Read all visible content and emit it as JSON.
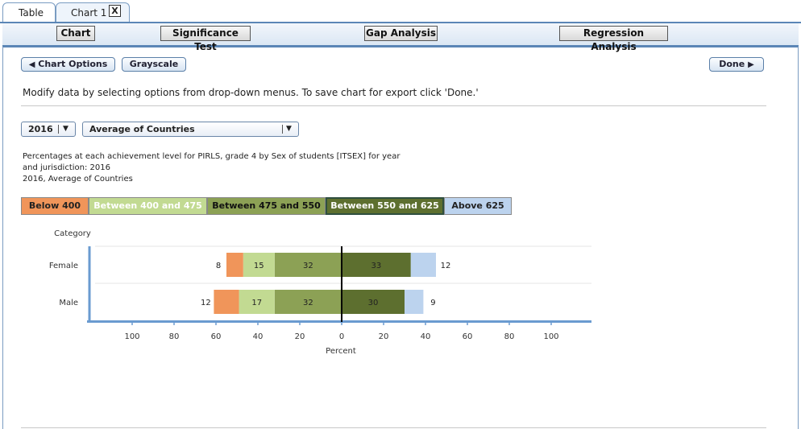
{
  "tabs": {
    "table": "Table",
    "chart1": "Chart 1",
    "close": "X"
  },
  "nav": {
    "chart": "Chart",
    "significance": "Significance Test",
    "gap": "Gap Analysis",
    "regression": "Regression Analysis"
  },
  "toolbar": {
    "chart_options": "Chart Options",
    "grayscale": "Grayscale",
    "done": "Done"
  },
  "instructions": "Modify data by selecting options from drop-down menus. To save chart for export click 'Done.'",
  "selects": {
    "year": "2016",
    "jurisdiction": "Average of Countries"
  },
  "description": [
    "Percentages at each achievement level for PIRLS, grade 4 by Sex of students [ITSEX] for year",
    "and jurisdiction: 2016",
    "2016, Average of Countries"
  ],
  "legend": [
    {
      "label": "Below 400",
      "color": "#f0955a",
      "text": "#222222"
    },
    {
      "label": "Between 400 and 475",
      "color": "#c2da92",
      "text": "#ffffff"
    },
    {
      "label": "Between 475 and 550",
      "color": "#8ca155",
      "text": "#111111"
    },
    {
      "label": "Between 550 and 625",
      "color": "#5d6f2f",
      "text": "#ffffff"
    },
    {
      "label": "Above 625",
      "color": "#bcd3ee",
      "text": "#222222"
    }
  ],
  "chart_data": {
    "type": "bar",
    "orientation": "horizontal-diverging",
    "stacked": true,
    "category_header": "Category",
    "categories": [
      "Female",
      "Male"
    ],
    "series": [
      {
        "name": "Below 400",
        "side": "left",
        "values": [
          8,
          12
        ]
      },
      {
        "name": "Between 400 and 475",
        "side": "left",
        "values": [
          15,
          17
        ]
      },
      {
        "name": "Between 475 and 550",
        "side": "left",
        "values": [
          32,
          32
        ]
      },
      {
        "name": "Between 550 and 625",
        "side": "right",
        "values": [
          33,
          30
        ]
      },
      {
        "name": "Above 625",
        "side": "right",
        "values": [
          12,
          9
        ]
      }
    ],
    "xlabel": "Percent",
    "xticks": [
      -100,
      -80,
      -60,
      -40,
      -20,
      0,
      20,
      40,
      60,
      80,
      100
    ],
    "xtick_labels": [
      "100",
      "80",
      "60",
      "40",
      "20",
      "0",
      "20",
      "40",
      "60",
      "80",
      "100"
    ],
    "xlim": [
      -120,
      120
    ],
    "grid": false
  }
}
